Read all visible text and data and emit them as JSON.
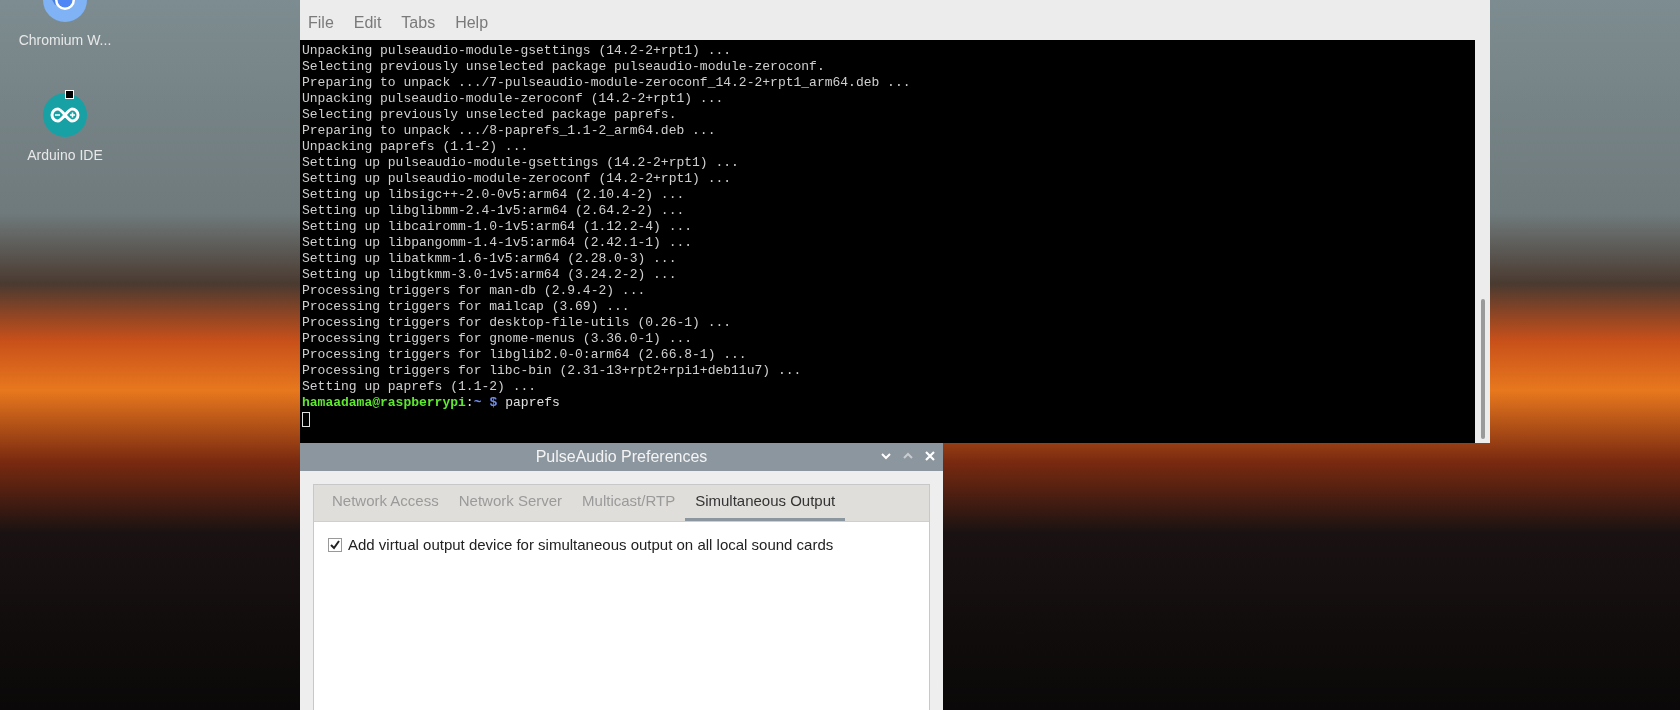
{
  "desktop_icons": [
    {
      "kind": "chromium",
      "label": "Chromium W...",
      "shortcut": false
    },
    {
      "kind": "arduino",
      "label": "Arduino IDE",
      "shortcut": true
    }
  ],
  "terminal": {
    "menu": [
      "File",
      "Edit",
      "Tabs",
      "Help"
    ],
    "lines": [
      "Unpacking pulseaudio-module-gsettings (14.2-2+rpt1) ...",
      "Selecting previously unselected package pulseaudio-module-zeroconf.",
      "Preparing to unpack .../7-pulseaudio-module-zeroconf_14.2-2+rpt1_arm64.deb ...",
      "Unpacking pulseaudio-module-zeroconf (14.2-2+rpt1) ...",
      "Selecting previously unselected package paprefs.",
      "Preparing to unpack .../8-paprefs_1.1-2_arm64.deb ...",
      "Unpacking paprefs (1.1-2) ...",
      "Setting up pulseaudio-module-gsettings (14.2-2+rpt1) ...",
      "Setting up pulseaudio-module-zeroconf (14.2-2+rpt1) ...",
      "Setting up libsigc++-2.0-0v5:arm64 (2.10.4-2) ...",
      "Setting up libglibmm-2.4-1v5:arm64 (2.64.2-2) ...",
      "Setting up libcairomm-1.0-1v5:arm64 (1.12.2-4) ...",
      "Setting up libpangomm-1.4-1v5:arm64 (2.42.1-1) ...",
      "Setting up libatkmm-1.6-1v5:arm64 (2.28.0-3) ...",
      "Setting up libgtkmm-3.0-1v5:arm64 (3.24.2-2) ...",
      "Processing triggers for man-db (2.9.4-2) ...",
      "Processing triggers for mailcap (3.69) ...",
      "Processing triggers for desktop-file-utils (0.26-1) ...",
      "Processing triggers for gnome-menus (3.36.0-1) ...",
      "Processing triggers for libglib2.0-0:arm64 (2.66.8-1) ...",
      "Processing triggers for libc-bin (2.31-13+rpt2+rpi1+deb11u7) ...",
      "Setting up paprefs (1.1-2) ..."
    ],
    "prompt": {
      "user_host": "hamaadama@raspberrypi",
      "separator": ":",
      "path": "~",
      "symbol": "$",
      "command": "paprefs"
    }
  },
  "dialog": {
    "title": "PulseAudio Preferences",
    "tabs": [
      {
        "label": "Network Access",
        "selected": false
      },
      {
        "label": "Network Server",
        "selected": false
      },
      {
        "label": "Multicast/RTP",
        "selected": false
      },
      {
        "label": "Simultaneous Output",
        "selected": true
      }
    ],
    "options": [
      {
        "label": "Add virtual output device for simultaneous output on all local sound cards",
        "checked": true
      }
    ]
  }
}
